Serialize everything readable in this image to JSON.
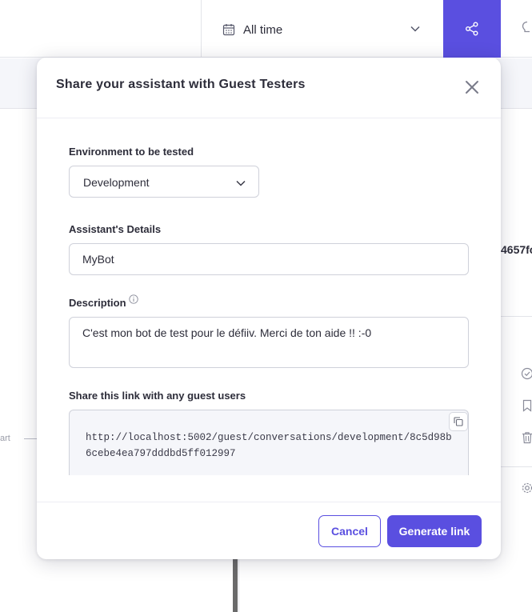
{
  "topbar": {
    "date_filter_label": "All time",
    "bg_hash_fragment": "4657fc",
    "bg_start_label": "art"
  },
  "modal": {
    "title": "Share your assistant with Guest Testers",
    "environment": {
      "label": "Environment to be tested",
      "selected": "Development"
    },
    "details": {
      "label": "Assistant's Details",
      "value": "MyBot"
    },
    "description": {
      "label": "Description",
      "value": "C'est mon bot de test pour le défiiv. Merci de ton aide !! :-0"
    },
    "share_link": {
      "label": "Share this link with any guest users",
      "url": "http://localhost:5002/guest/conversations/development/8c5d98b6cebe4ea797dddbd5ff012997"
    },
    "buttons": {
      "cancel": "Cancel",
      "generate": "Generate link"
    }
  },
  "colors": {
    "accent": "#5a4fe0",
    "text": "#2d2d3a",
    "border": "#cfd1da",
    "panel_bg": "#f5f6fa"
  }
}
